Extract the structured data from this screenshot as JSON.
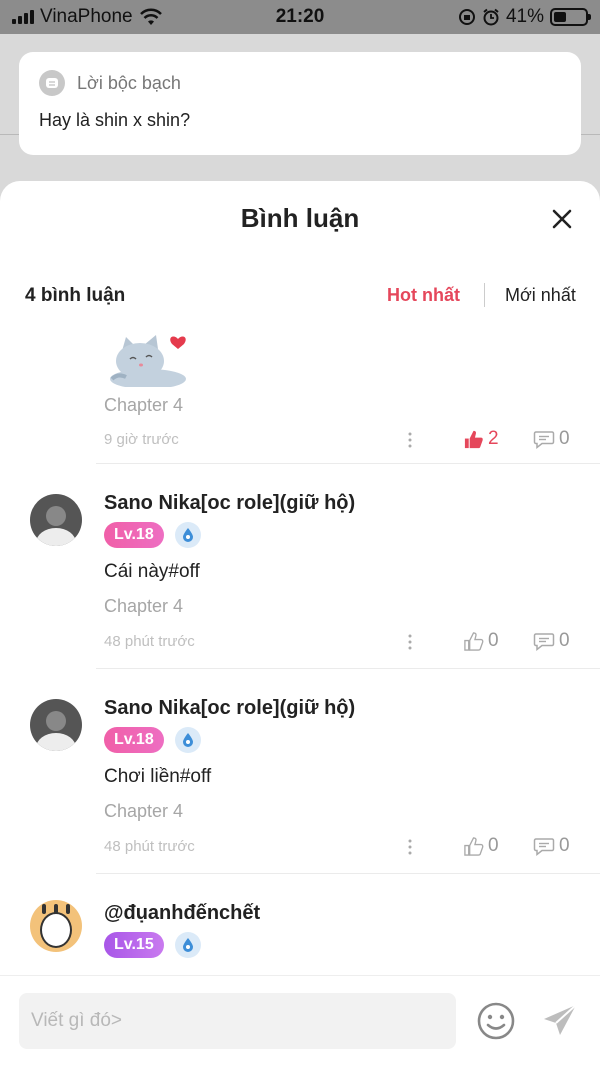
{
  "status_bar": {
    "carrier": "VinaPhone",
    "time": "21:20",
    "battery": "41%",
    "battery_level": 0.41
  },
  "confession": {
    "label": "Lời bộc bạch",
    "text": "Hay là shin x shin?"
  },
  "sheet": {
    "title": "Bình luận",
    "comment_count": "4 bình luận",
    "sort_hot": "Hot nhất",
    "sort_new": "Mới nhất"
  },
  "comments": [
    {
      "sticker": "cat-heart-sticker",
      "chapter": "Chapter 4",
      "time": "9 giờ trước",
      "likes": "2",
      "replies": "0"
    },
    {
      "username": "Sano Nika[oc role](giữ hộ)",
      "level": "Lv.18",
      "text": "Cái này#off",
      "chapter": "Chapter 4",
      "time": "48 phút trước",
      "likes": "0",
      "replies": "0"
    },
    {
      "username": "Sano Nika[oc role](giữ hộ)",
      "level": "Lv.18",
      "text": "Chơi liền#off",
      "chapter": "Chapter 4",
      "time": "48 phút trước",
      "likes": "0",
      "replies": "0"
    },
    {
      "username": "@đụanhđếnchết",
      "level": "Lv.15"
    }
  ],
  "input": {
    "placeholder": "Viết gì đó>"
  },
  "colors": {
    "accent": "#e5475b",
    "level_pink": "#f05fa8",
    "level_purple": "#a856e8"
  }
}
